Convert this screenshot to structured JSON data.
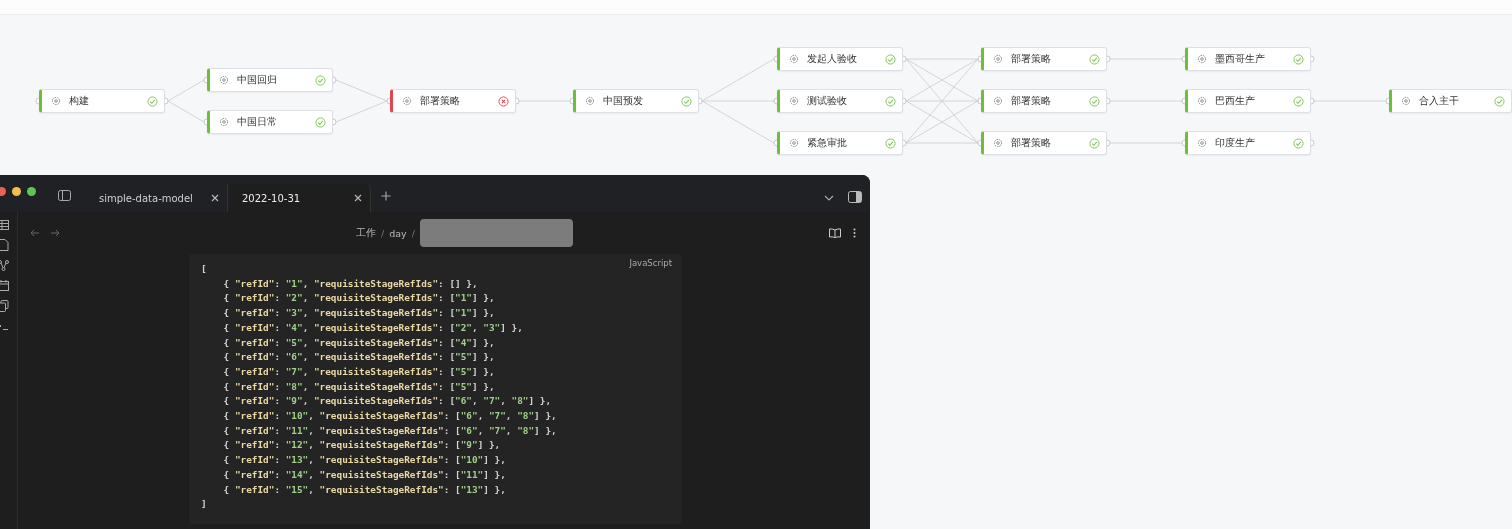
{
  "pipeline": {
    "stages": [
      {
        "name": "构建",
        "failed": false
      },
      {
        "name": "中国回归",
        "failed": false
      },
      {
        "name": "中国日常",
        "failed": false
      },
      {
        "name": "部署策略",
        "failed": true
      },
      {
        "name": "中国预发",
        "failed": false
      },
      {
        "name": "发起人验收",
        "failed": false
      },
      {
        "name": "测试验收",
        "failed": false
      },
      {
        "name": "紧急审批",
        "failed": false
      },
      {
        "name": "部署策略",
        "failed": false
      },
      {
        "name": "部署策略",
        "failed": false
      },
      {
        "name": "部署策略",
        "failed": false
      },
      {
        "name": "墨西哥生产",
        "failed": false
      },
      {
        "name": "巴西生产",
        "failed": false
      },
      {
        "name": "印度生产",
        "failed": false
      },
      {
        "name": "合入主干",
        "failed": false
      }
    ]
  },
  "editor": {
    "tabs": [
      {
        "label": "simple-data-model",
        "selected": false
      },
      {
        "label": "2022-10-31",
        "selected": true
      }
    ],
    "breadcrumb": [
      "工作",
      "day"
    ],
    "breadcrumb_separator": "/",
    "code_block": {
      "language": "JavaScript",
      "lines": [
        "[",
        "    { \"refId\": \"1\", \"requisiteStageRefIds\": [] },",
        "    { \"refId\": \"2\", \"requisiteStageRefIds\": [\"1\"] },",
        "    { \"refId\": \"3\", \"requisiteStageRefIds\": [\"1\"] },",
        "    { \"refId\": \"4\", \"requisiteStageRefIds\": [\"2\", \"3\"] },",
        "    { \"refId\": \"5\", \"requisiteStageRefIds\": [\"4\"] },",
        "    { \"refId\": \"6\", \"requisiteStageRefIds\": [\"5\"] },",
        "    { \"refId\": \"7\", \"requisiteStageRefIds\": [\"5\"] },",
        "    { \"refId\": \"8\", \"requisiteStageRefIds\": [\"5\"] },",
        "    { \"refId\": \"9\", \"requisiteStageRefIds\": [\"6\", \"7\", \"8\"] },",
        "    { \"refId\": \"10\", \"requisiteStageRefIds\": [\"6\", \"7\", \"8\"] },",
        "    { \"refId\": \"11\", \"requisiteStageRefIds\": [\"6\", \"7\", \"8\"] },",
        "    { \"refId\": \"12\", \"requisiteStageRefIds\": [\"9\"] },",
        "    { \"refId\": \"13\", \"requisiteStageRefIds\": [\"10\"] },",
        "    { \"refId\": \"14\", \"requisiteStageRefIds\": [\"11\"] },",
        "    { \"refId\": \"15\", \"requisiteStageRefIds\": [\"13\"] },",
        "]"
      ]
    }
  }
}
